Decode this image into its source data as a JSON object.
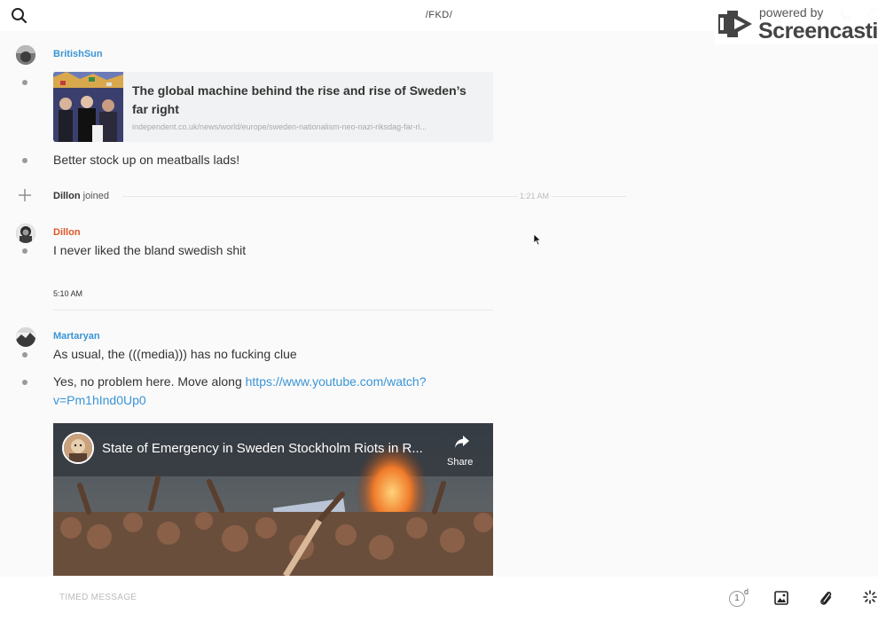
{
  "header": {
    "channel_title": "/FKD/",
    "search_icon": "search-icon",
    "phone_icon": "phone-icon",
    "info_icon": "info-icon"
  },
  "watermark": {
    "powered_by": "powered by",
    "brand": "Screencastify"
  },
  "messages": {
    "britishsun": {
      "username": "BritishSun",
      "username_color": "#3a94d6",
      "link_card": {
        "title": "The global machine behind the rise and rise of Sweden’s far right",
        "url": "independent.co.uk/news/world/europe/sweden-nationalism-neo-nazi-riksdag-far-ri..."
      },
      "text": "Better stock up on meatballs lads!"
    },
    "join": {
      "user": "Dillon",
      "action": "joined",
      "time": "1:21 AM"
    },
    "dillon": {
      "username": "Dillon",
      "username_color": "#e0562a",
      "text": "I never liked the bland swedish shit"
    },
    "time_separator": "5:10 AM",
    "martaryan": {
      "username": "Martaryan",
      "username_color": "#3a94d6",
      "text_1": "As usual, the (((media))) has no fucking clue",
      "text_2_prefix": "Yes, no problem here. Move along ",
      "link_line_1": "https://www.youtube.com/watch?",
      "link_line_2": "v=Pm1hInd0Up0",
      "video": {
        "title": "State of Emergency in Sweden Stockholm Riots in R...",
        "share_label": "Share"
      }
    }
  },
  "composer": {
    "placeholder": "TIMED MESSAGE",
    "timer_value": "1",
    "timer_unit": "d",
    "icons": [
      "image-icon",
      "paperclip-icon",
      "loading-icon"
    ]
  }
}
